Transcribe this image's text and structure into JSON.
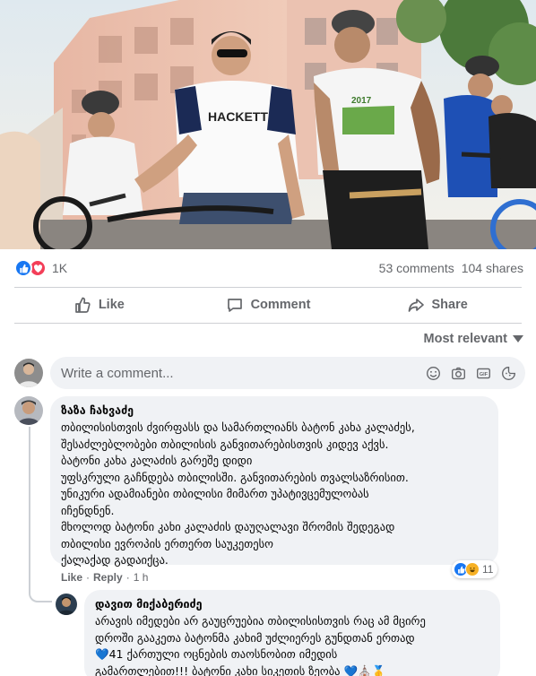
{
  "post": {
    "reaction_count": "1K",
    "comments_count": "53 comments",
    "shares_count": "104 shares",
    "reaction_types": [
      "like",
      "love"
    ],
    "shirt_brand_text": "HACKETT",
    "shirt_event_text": "2017"
  },
  "actions": {
    "like": "Like",
    "comment": "Comment",
    "share": "Share"
  },
  "sort": {
    "label": "Most relevant"
  },
  "composer": {
    "placeholder": "Write a comment..."
  },
  "comments": [
    {
      "author": "ზაზა ჩახვაძე",
      "lines": [
        "თბილისისთვის ძვირფასს და სამართლიანს ბატონ კახა კალაძეს,",
        "შესაძლებლობები თბილისის განვითარებისთვის კიდევ აქვს.",
        "ბატონი კახა კალაძის გარეშე დიდი",
        "უფსკრული გაჩნდება თბილისში. განვითარების თვალსაზრისით.",
        "უნიკური ადამიანები თბილისი მიმართ უპატივცემულობას",
        "იჩენდნენ.",
        "მხოლოდ ბატონი კახი კალაძის დაუღალავი შრომის შედეგად",
        "თბილისი ევროპის ერთერთ საუკეთესო",
        "ქალაქად გადაიქცა."
      ],
      "like_label": "Like",
      "reply_label": "Reply",
      "time": "1 h",
      "reaction_count": "11",
      "reaction_types": [
        "like",
        "haha"
      ]
    },
    {
      "author": "დავით მიქაბერიძე",
      "lines": [
        "არავის იმედები არ გაუცრუებია თბილისისთვის რაც ამ მცირე",
        "დროში გააკეთა ბატონმა კახიმ უძლიერეს გუნდთან ერთად",
        "41 ქართული ოცნების თაოსნობით იმედის",
        "გამართლებით!!! ბატონი კახი სიკეთის ზეობა"
      ],
      "emoji_inline": [
        "💙",
        "💙",
        "🙏",
        "⛪"
      ],
      "emoji_end": [
        "💙",
        "⛪",
        "🥇"
      ]
    }
  ],
  "colors": {
    "facebook_blue": "#1877f2",
    "love_red": "#f33e58",
    "haha_yellow": "#f7b125",
    "secondary_text": "#65676b",
    "bubble_bg": "#f0f2f5"
  }
}
